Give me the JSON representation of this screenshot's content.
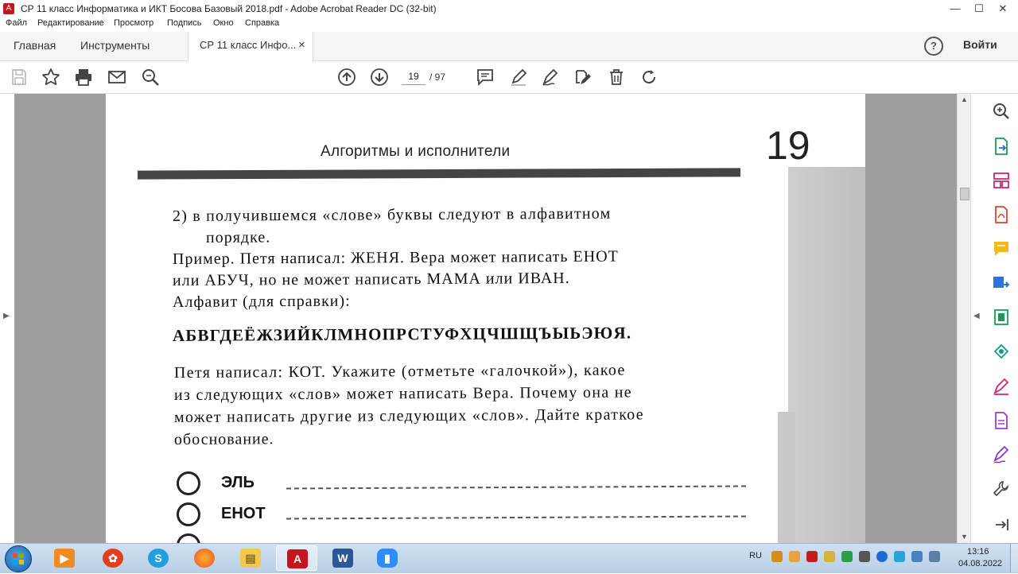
{
  "window": {
    "title": "СР 11 класс Информатика и ИКТ Босова Базовый 2018.pdf - Adobe Acrobat Reader DC (32-bit)",
    "app_icon": "acrobat-icon",
    "controls": {
      "minimize": "—",
      "maximize": "☐",
      "close": "✕"
    }
  },
  "menu": [
    "Файл",
    "Редактирование",
    "Просмотр",
    "Подпись",
    "Окно",
    "Справка"
  ],
  "tabs": {
    "home": "Главная",
    "tools": "Инструменты",
    "document": "СР 11 класс Инфо...",
    "close_glyph": "×",
    "help": "?",
    "signin": "Войти"
  },
  "toolbar": {
    "icons": [
      "save-icon",
      "bookmark-star-icon",
      "print-icon",
      "email-icon",
      "search-icon",
      "page-up-icon",
      "page-down-icon",
      "comment-icon",
      "highlight-icon",
      "sign-icon",
      "edit-pdf-icon",
      "delete-icon",
      "rotate-icon"
    ],
    "page_current": "19",
    "page_total": "/ 97"
  },
  "document": {
    "running_head": "Алгоритмы и исполнители",
    "page_number": "19",
    "lines": [
      "2)  в получившемся «слове» буквы следуют в алфавитном",
      "порядке.",
      "Пример. Петя написал: ЖЕНЯ. Вера может написать ЕНОТ",
      "или АБУЧ, но не может написать МАМА или ИВАН.",
      "Алфавит (для справки):",
      "АБВГДЕЁЖЗИЙКЛМНОПРСТУФХЦЧШЩЪЫЬЭЮЯ.",
      "Петя написал: КОТ. Укажите (отметьте «галочкой»), какое",
      "из следующих «слов» может написать Вера. Почему она не",
      "может написать другие из следующих «слов». Дайте краткое",
      "обоснование."
    ],
    "options": [
      "ЭЛЬ",
      "ЕНОТ"
    ]
  },
  "right_panel": {
    "icons": [
      "zoom-icon",
      "export-pdf-icon",
      "organize-pages-icon",
      "create-pdf-icon",
      "comment-icon",
      "send-for-review-icon",
      "compress-icon",
      "share-icon",
      "fill-sign-icon",
      "edit-pdf-icon",
      "sign-icon",
      "more-tools-icon",
      "collapse-icon"
    ]
  },
  "taskbar": {
    "apps": [
      "windows-start",
      "media-player-icon",
      "app-grid-icon",
      "skype-icon",
      "firefox-icon",
      "file-explorer-icon",
      "acrobat-icon",
      "word-icon",
      "zoom-icon"
    ],
    "language": "RU",
    "time": "13:16",
    "date": "04.08.2022"
  },
  "colors": {
    "acrobat_red": "#c4161c",
    "document_bg": "#9e9e9e",
    "taskbar_top": "#cfe0f0"
  }
}
